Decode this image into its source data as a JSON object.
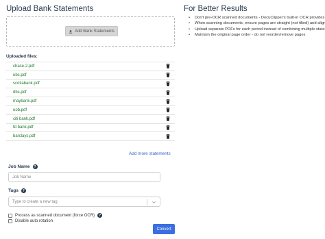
{
  "upload": {
    "title": "Upload Bank Statements",
    "button_label": "Add Bank Statements"
  },
  "tips": {
    "title": "For Better Results",
    "items": [
      "Don't pre-OCR scanned documents - DocuClipper's built-in OCR provides better results",
      "When scanning documents, ensure pages are straight (not tilted) and aligned",
      "Upload separate PDFs for each period instead of combining multiple statements",
      "Maintain the original page order - do not reorder/remove pages"
    ]
  },
  "files": {
    "label": "Uploaded files:",
    "items": [
      "chase-2.pdf",
      "ubs.pdf",
      "scotiabank.pdf",
      "dbs.pdf",
      "maybank.pdf",
      "uob.pdf",
      "citi bank.pdf",
      "td bank.pdf",
      "barclays.pdf"
    ]
  },
  "add_more_label": "Add more statements",
  "job_name": {
    "label": "Job Name",
    "placeholder": "Job Name"
  },
  "tags": {
    "label": "Tags",
    "placeholder": "Type to create a new tag"
  },
  "options": {
    "scanned_label": "Process as scanned document (force OCR)",
    "rotation_label": "Disable auto rotation"
  },
  "convert_label": "Convert",
  "colors": {
    "accent": "#3b6fe0",
    "file_link": "#1e7b2a",
    "heading": "#2b3a4f"
  }
}
